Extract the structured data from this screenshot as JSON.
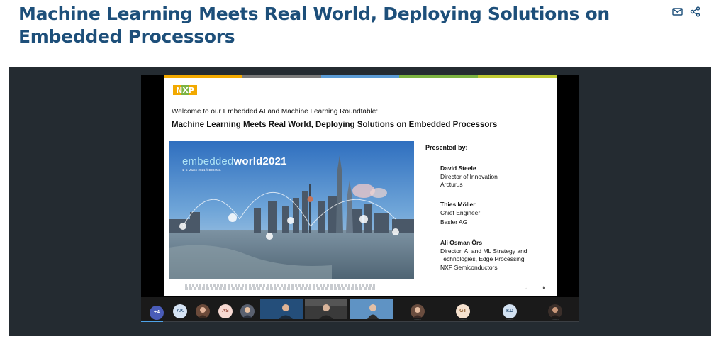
{
  "page": {
    "title": "Machine Learning Meets Real World, Deploying Solutions on Embedded Processors"
  },
  "actions": {
    "email_icon": "email-icon",
    "share_icon": "share-icon"
  },
  "slide": {
    "logo": "NXP",
    "welcome": "Welcome to our Embedded AI and Machine Learning Roundtable:",
    "title": "Machine Learning Meets Real World, Deploying Solutions on Embedded Processors",
    "event_name_light": "embedded",
    "event_name_bold": "world",
    "event_year": "2021",
    "event_date": "1–5 March 2021 // DIGITAL",
    "presented_by": "Presented by:",
    "presenters": [
      {
        "name": "David Steele",
        "role": "Director of Innovation",
        "org": "Arcturus"
      },
      {
        "name": "Thies Möller",
        "role": "Chief Engineer",
        "org": "Basler AG"
      },
      {
        "name": "Ali Osman Örs",
        "role": "Director, AI and ML Strategy and",
        "role2": "Technologies, Edge Processing",
        "org": "NXP Semiconductors"
      }
    ],
    "page_number": "0",
    "colors": {
      "bar1": "#f2a900",
      "bar2": "#7a7a7a",
      "bar3": "#5b9bd5",
      "bar4": "#7cb342",
      "bar5": "#c0ca33"
    }
  },
  "participants": {
    "more_count": "+4",
    "avatars": [
      {
        "initials": "AK",
        "bg": "#d6e4f5",
        "fg": "#355a80"
      },
      {
        "initials": "AS",
        "bg": "#f7d9d2",
        "fg": "#9a4a3a"
      },
      {
        "initials": "GT",
        "bg": "#f6e2cf",
        "fg": "#8a5a2a"
      },
      {
        "initials": "KD",
        "bg": "#d3e2f2",
        "fg": "#34587c"
      }
    ]
  },
  "colors": {
    "title": "#1d4f7a",
    "player_bg": "#242b31",
    "progress": "#4fa3e8"
  }
}
